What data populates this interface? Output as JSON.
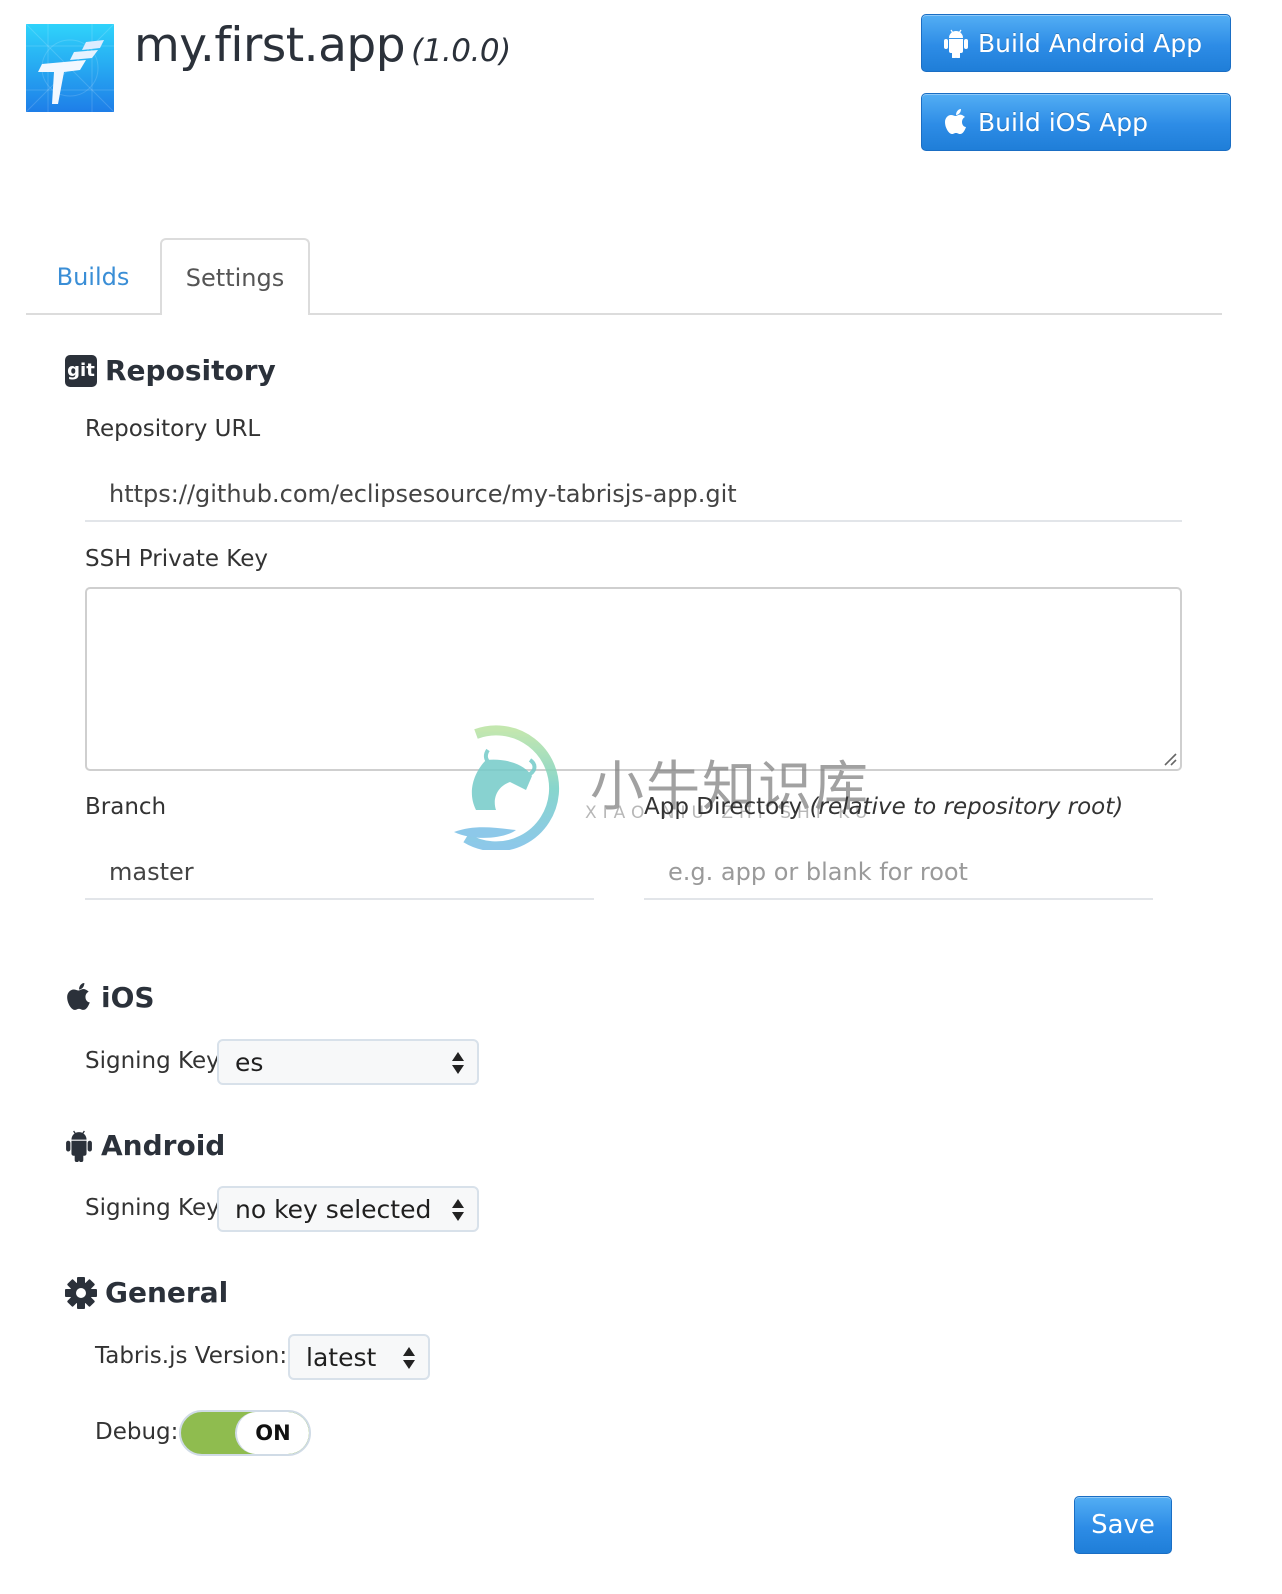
{
  "header": {
    "app_name": "my.first.app",
    "app_version": "(1.0.0)",
    "build_android_label": "Build Android App",
    "build_ios_label": "Build iOS App"
  },
  "tabs": [
    {
      "label": "Builds",
      "active": false
    },
    {
      "label": "Settings",
      "active": true
    }
  ],
  "repository": {
    "heading": "Repository",
    "badge": "git",
    "url_label": "Repository URL",
    "url_value": "https://github.com/eclipsesource/my-tabrisjs-app.git",
    "ssh_label": "SSH Private Key",
    "ssh_value": "",
    "branch_label": "Branch",
    "branch_value": "master",
    "app_dir_label": "App Directory",
    "app_dir_note": "(relative to repository root)",
    "app_dir_value": "",
    "app_dir_placeholder": "e.g. app or blank for root"
  },
  "ios": {
    "heading": "iOS",
    "signing_label": "Signing Key",
    "signing_value": "es"
  },
  "android": {
    "heading": "Android",
    "signing_label": "Signing Key",
    "signing_value": "no key selected"
  },
  "general": {
    "heading": "General",
    "version_label": "Tabris.js Version:",
    "version_value": "latest",
    "debug_label": "Debug:",
    "debug_state": "ON"
  },
  "save_label": "Save",
  "watermark": {
    "cn": "小牛知识库",
    "en": "XIAO NIU ZHI SHI KU"
  },
  "colors": {
    "primary": "#2d8ce6",
    "link": "#3a8ed6",
    "toggle_on": "#8fbc4f",
    "text": "#2b313a"
  }
}
